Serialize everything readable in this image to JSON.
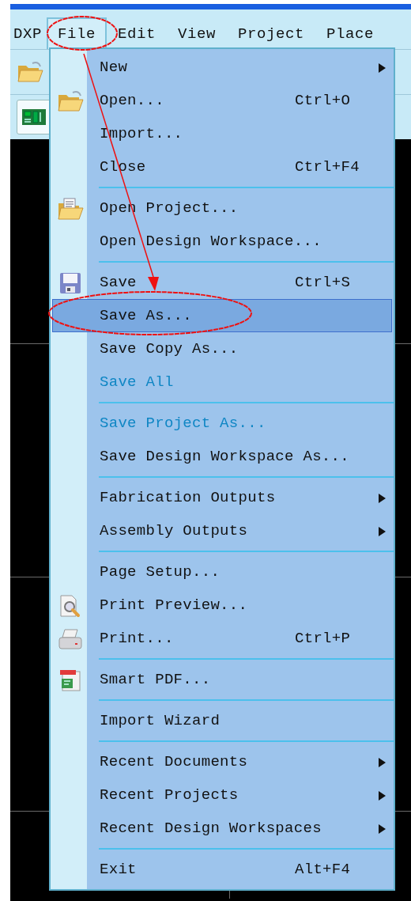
{
  "menubar": [
    {
      "label": "DXP",
      "selected": false
    },
    {
      "label": "File",
      "selected": true
    },
    {
      "label": "Edit",
      "selected": false
    },
    {
      "label": "View",
      "selected": false
    },
    {
      "label": "Project",
      "selected": false
    },
    {
      "label": "Place",
      "selected": false
    }
  ],
  "file_menu": [
    {
      "kind": "item",
      "label": "New",
      "submenu": true,
      "disabled": false,
      "selected": false
    },
    {
      "kind": "item",
      "label": "Open...",
      "shortcut": "Ctrl+O",
      "disabled": false,
      "selected": false
    },
    {
      "kind": "item",
      "label": "Import...",
      "disabled": false,
      "selected": false
    },
    {
      "kind": "item",
      "label": "Close",
      "shortcut": "Ctrl+F4",
      "disabled": false,
      "selected": false
    },
    {
      "kind": "separator"
    },
    {
      "kind": "item",
      "label": "Open Project...",
      "disabled": false,
      "selected": false
    },
    {
      "kind": "item",
      "label": "Open Design Workspace...",
      "disabled": false,
      "selected": false
    },
    {
      "kind": "separator"
    },
    {
      "kind": "item",
      "label": "Save",
      "shortcut": "Ctrl+S",
      "disabled": false,
      "selected": false
    },
    {
      "kind": "item",
      "label": "Save As...",
      "disabled": false,
      "selected": true
    },
    {
      "kind": "item",
      "label": "Save Copy As...",
      "disabled": false,
      "selected": false
    },
    {
      "kind": "item",
      "label": "Save All",
      "disabled": true,
      "selected": false
    },
    {
      "kind": "separator"
    },
    {
      "kind": "item",
      "label": "Save Project As...",
      "disabled": true,
      "selected": false
    },
    {
      "kind": "item",
      "label": "Save Design Workspace As...",
      "disabled": false,
      "selected": false
    },
    {
      "kind": "separator"
    },
    {
      "kind": "item",
      "label": "Fabrication Outputs",
      "submenu": true,
      "disabled": false,
      "selected": false
    },
    {
      "kind": "item",
      "label": "Assembly Outputs",
      "submenu": true,
      "disabled": false,
      "selected": false
    },
    {
      "kind": "separator"
    },
    {
      "kind": "item",
      "label": "Page Setup...",
      "disabled": false,
      "selected": false
    },
    {
      "kind": "item",
      "label": "Print Preview...",
      "disabled": false,
      "selected": false
    },
    {
      "kind": "item",
      "label": "Print...",
      "shortcut": "Ctrl+P",
      "disabled": false,
      "selected": false
    },
    {
      "kind": "separator"
    },
    {
      "kind": "item",
      "label": "Smart PDF...",
      "disabled": false,
      "selected": false
    },
    {
      "kind": "separator"
    },
    {
      "kind": "item",
      "label": "Import Wizard",
      "disabled": false,
      "selected": false
    },
    {
      "kind": "separator"
    },
    {
      "kind": "item",
      "label": "Recent Documents",
      "submenu": true,
      "disabled": false,
      "selected": false
    },
    {
      "kind": "item",
      "label": "Recent Projects",
      "submenu": true,
      "disabled": false,
      "selected": false
    },
    {
      "kind": "item",
      "label": "Recent Design Workspaces",
      "submenu": true,
      "disabled": false,
      "selected": false
    },
    {
      "kind": "separator"
    },
    {
      "kind": "item",
      "label": "Exit",
      "shortcut": "Alt+F4",
      "disabled": false,
      "selected": false
    }
  ]
}
